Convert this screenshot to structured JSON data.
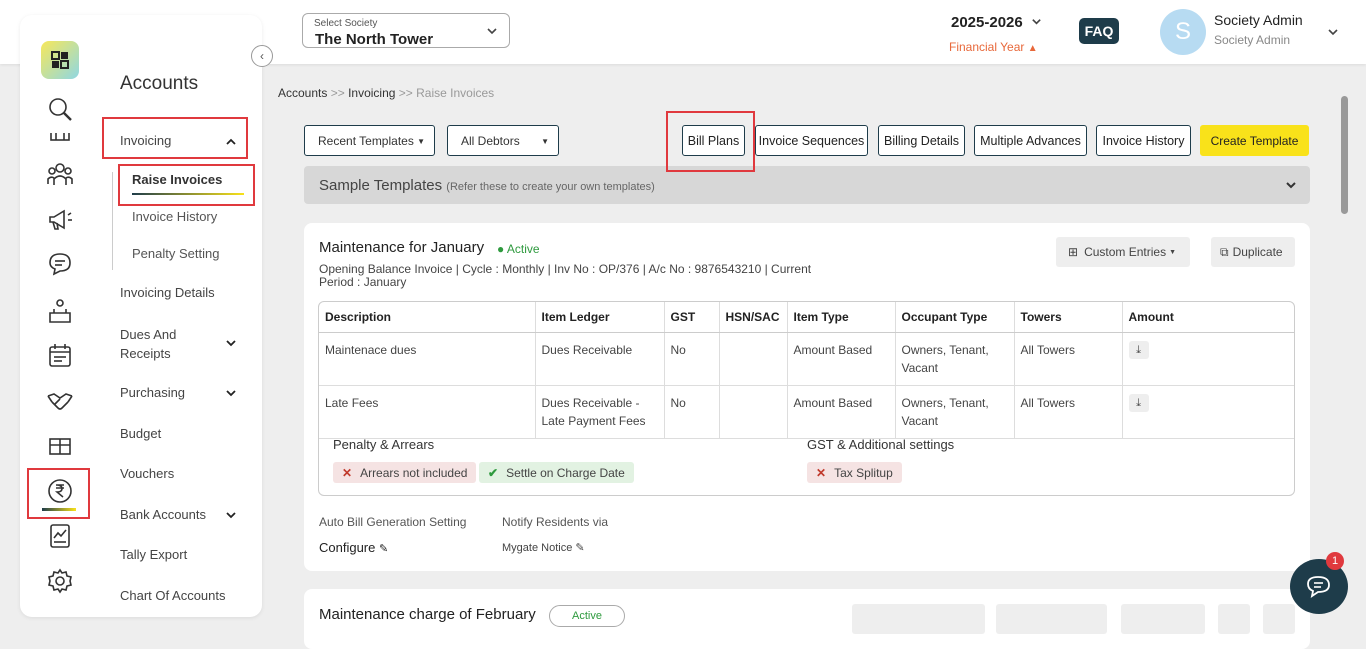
{
  "header": {
    "society_label": "Select Society",
    "society_value": "The North Tower",
    "financial_year": "2025-2026",
    "financial_year_label": "Financial Year",
    "faq": "FAQ",
    "avatar_letter": "S",
    "user_name": "Society Admin",
    "user_role": "Society Admin"
  },
  "sidebar": {
    "title": "Accounts",
    "items": [
      {
        "label": "Invoicing",
        "expanded": true
      },
      {
        "label": "Raise Invoices",
        "active": true
      },
      {
        "label": "Invoice History"
      },
      {
        "label": "Penalty Setting"
      },
      {
        "label": "Invoicing Details"
      },
      {
        "label": "Dues And Receipts"
      },
      {
        "label": "Purchasing"
      },
      {
        "label": "Budget"
      },
      {
        "label": "Vouchers"
      },
      {
        "label": "Bank Accounts"
      },
      {
        "label": "Tally Export"
      },
      {
        "label": "Chart Of Accounts"
      }
    ],
    "rail_icons": [
      "search-icon",
      "building-icon",
      "people-icon",
      "megaphone-icon",
      "chat-icon",
      "service-icon",
      "calendar-icon",
      "handshake-icon",
      "package-icon",
      "rupee-icon",
      "chart-icon",
      "gear-icon"
    ]
  },
  "breadcrumb": {
    "a": "Accounts",
    "sep1": ">>",
    "b": "Invoicing",
    "sep2": ">>",
    "c": "Raise Invoices"
  },
  "toolbar": {
    "recent_templates": "Recent Templates",
    "all_debtors": "All Debtors",
    "bill_plans": "Bill Plans",
    "invoice_sequences": "Invoice Sequences",
    "billing_details": "Billing Details",
    "multiple_advances": "Multiple Advances",
    "invoice_history": "Invoice History",
    "create_template": "Create Template"
  },
  "samples": {
    "title": "Sample Templates",
    "hint": "(Refer these to create your own templates)"
  },
  "template": {
    "title": "Maintenance for January",
    "status": "Active",
    "meta": "Opening Balance Invoice | Cycle : Monthly | Inv No : OP/376 | A/c No : 9876543210 | Current",
    "period": "Period : January",
    "custom_entries": "Custom Entries",
    "duplicate": "Duplicate",
    "columns": [
      "Description",
      "Item Ledger",
      "GST",
      "HSN/SAC",
      "Item Type",
      "Occupant Type",
      "Towers",
      "Amount"
    ],
    "rows": [
      [
        "Maintenace dues",
        "Dues Receivable",
        "No",
        "",
        "Amount Based",
        "Owners, Tenant, Vacant",
        "All Towers"
      ],
      [
        "Late Fees",
        "Dues Receivable -Late Payment Fees",
        "No",
        "",
        "Amount Based",
        "Owners, Tenant, Vacant",
        "All Towers"
      ]
    ],
    "penalty_heading": "Penalty & Arrears",
    "arrears": "Arrears not included",
    "settle": "Settle on Charge Date",
    "gst_heading": "GST & Additional settings",
    "tax_splitup": "Tax Splitup",
    "auto_bill_label": "Auto Bill Generation Setting",
    "configure": "Configure",
    "notify_label": "Notify Residents via",
    "notify_value": "Mygate Notice"
  },
  "template2": {
    "title": "Maintenance charge of February",
    "status": "Active"
  },
  "chat_badge": "1",
  "colors": {
    "accent_red": "#e0393e",
    "brand_dark": "#1e3c4a",
    "create_yellow": "#f9e21a",
    "fy_orange": "#e8683a",
    "active_green": "#2e9a3e"
  }
}
